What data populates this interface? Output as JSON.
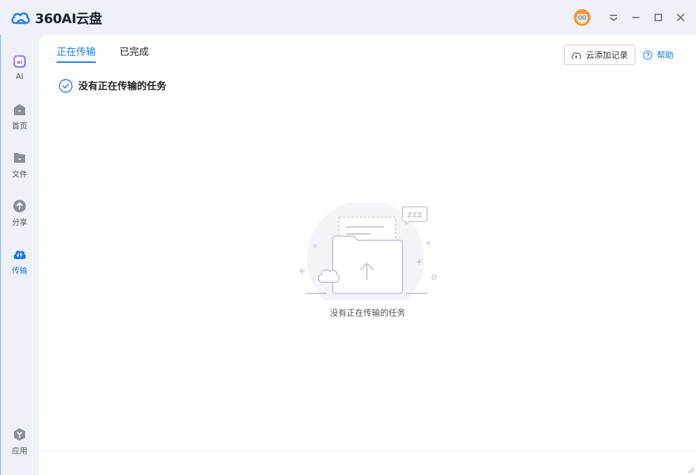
{
  "app": {
    "title": "360AI云盘"
  },
  "sidebar": {
    "items": [
      {
        "label": "AI",
        "icon": "ai-icon"
      },
      {
        "label": "首页",
        "icon": "home-icon"
      },
      {
        "label": "文件",
        "icon": "folder-icon"
      },
      {
        "label": "分享",
        "icon": "share-icon"
      },
      {
        "label": "传输",
        "icon": "transfer-icon",
        "active": true
      },
      {
        "label": "应用",
        "icon": "apps-icon"
      }
    ]
  },
  "tabs": [
    {
      "label": "正在传输",
      "active": true
    },
    {
      "label": "已完成",
      "active": false
    }
  ],
  "toolbar": {
    "cloud_add_label": "云添加记录",
    "help_label": "帮助"
  },
  "status": {
    "heading": "没有正在传输的任务"
  },
  "empty_state": {
    "message": "没有正在传输的任务",
    "zzz": "ZZZ"
  },
  "colors": {
    "accent": "#1f7ae6",
    "background": "#eef1f8",
    "panel": "#ffffff"
  }
}
